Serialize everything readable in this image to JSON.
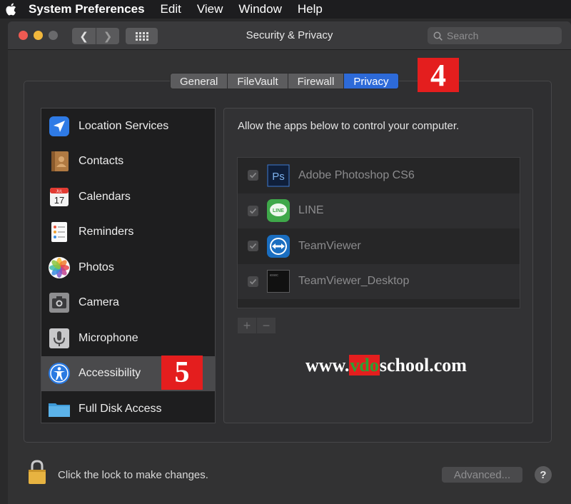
{
  "menubar": {
    "app_name": "System Preferences",
    "items": [
      "Edit",
      "View",
      "Window",
      "Help"
    ]
  },
  "window": {
    "title": "Security & Privacy",
    "search_placeholder": "Search"
  },
  "tabs": [
    {
      "label": "General",
      "active": false
    },
    {
      "label": "FileVault",
      "active": false
    },
    {
      "label": "Firewall",
      "active": false
    },
    {
      "label": "Privacy",
      "active": true
    }
  ],
  "annotations": {
    "step_tabs": "4",
    "step_sidebar": "5"
  },
  "sidebar": {
    "items": [
      {
        "label": "Location Services",
        "icon": "location-arrow-icon"
      },
      {
        "label": "Contacts",
        "icon": "contacts-book-icon"
      },
      {
        "label": "Calendars",
        "icon": "calendar-icon"
      },
      {
        "label": "Reminders",
        "icon": "reminders-list-icon"
      },
      {
        "label": "Photos",
        "icon": "photos-flower-icon"
      },
      {
        "label": "Camera",
        "icon": "camera-icon"
      },
      {
        "label": "Microphone",
        "icon": "microphone-icon"
      },
      {
        "label": "Accessibility",
        "icon": "accessibility-figure-icon",
        "selected": true
      },
      {
        "label": "Full Disk Access",
        "icon": "folder-icon"
      }
    ]
  },
  "main": {
    "description": "Allow the apps below to control your computer.",
    "apps": [
      {
        "name": "Adobe Photoshop CS6",
        "checked": true,
        "icon": "photoshop-icon",
        "icon_text": "Ps"
      },
      {
        "name": "LINE",
        "checked": true,
        "icon": "line-app-icon",
        "icon_text": "LINE"
      },
      {
        "name": "TeamViewer",
        "checked": true,
        "icon": "teamviewer-icon"
      },
      {
        "name": "TeamViewer_Desktop",
        "checked": true,
        "icon": "terminal-icon",
        "icon_text": "exec"
      }
    ],
    "add_label": "+",
    "remove_label": "−"
  },
  "watermark": {
    "prefix": "www.",
    "highlight": "vdo",
    "suffix": "school.com"
  },
  "footer": {
    "lock_text": "Click the lock to make changes.",
    "advanced_label": "Advanced...",
    "help_label": "?"
  },
  "colors": {
    "accent": "#2d6ad8",
    "annotation_red": "#e41e1e"
  }
}
